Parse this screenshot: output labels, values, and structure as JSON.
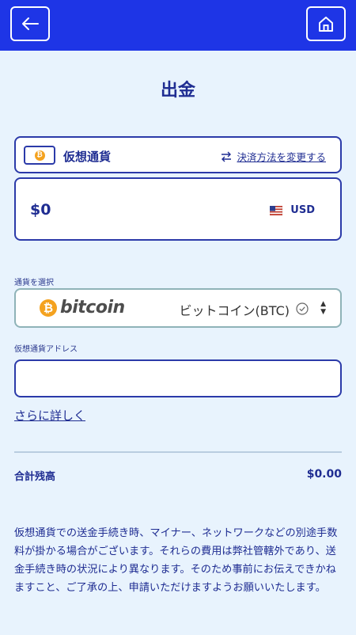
{
  "header": {
    "back_icon": "arrow-left-icon",
    "home_icon": "home-icon"
  },
  "page": {
    "title": "出金"
  },
  "payment_method": {
    "label": "仮想通貨",
    "change_label": "決済方法を変更する",
    "icon": "bitcoin-icon"
  },
  "amount": {
    "value": "$0",
    "currency": "USD",
    "flag_icon": "us-flag-icon"
  },
  "currency_select": {
    "label": "通貨を選択",
    "brand": "bitcoin",
    "brand_symbol": "₿",
    "selected": "ビットコイン(BTC)"
  },
  "address": {
    "label": "仮想通貨アドレス",
    "value": ""
  },
  "more_link": "さらに詳しく",
  "total": {
    "label": "合計残高",
    "value": "$0.00"
  },
  "note": "仮想通貨での送金手続き時、マイナー、ネットワークなどの別途手数料が掛かる場合がございます。それらの費用は弊社管轄外であり、送金手続き時の状況により異なります。そのため事前にお伝えできかねますこと、ご了承の上、申請いただけますようお願いいたします。",
  "colors": {
    "header": "#1e35e6",
    "background": "#e8f3fd",
    "primary_text": "#1f2d92",
    "bitcoin": "#f4a21f"
  }
}
